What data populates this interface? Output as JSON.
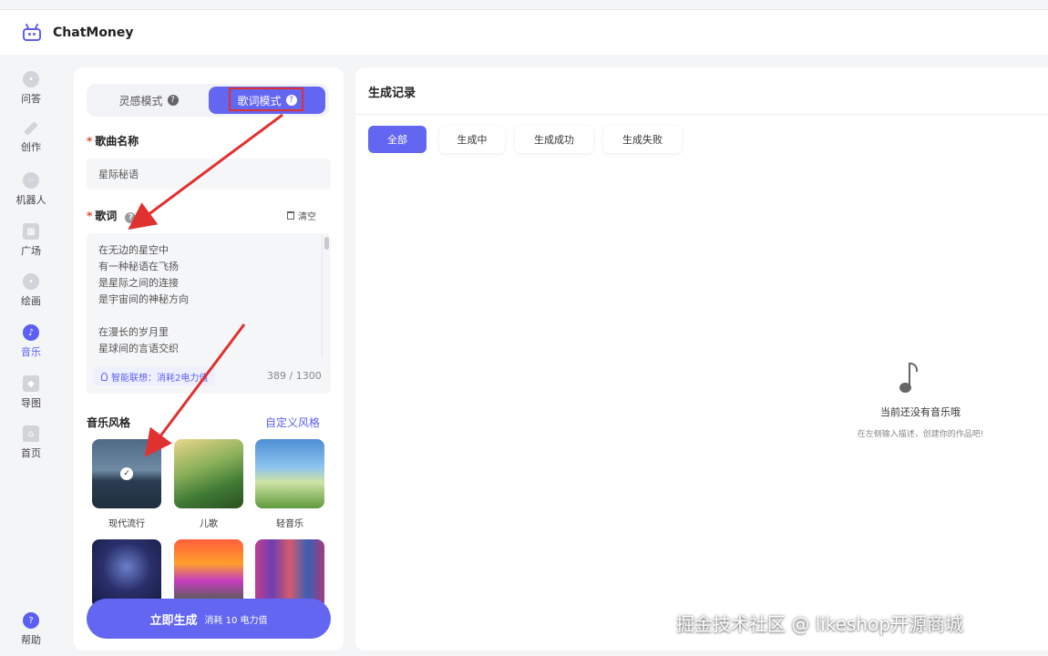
{
  "app": {
    "title": "ChatMoney"
  },
  "sidebar": {
    "items": [
      {
        "label": "问答",
        "icon": "chat-icon"
      },
      {
        "label": "创作",
        "icon": "pen-icon"
      },
      {
        "label": "机器人",
        "icon": "robot-icon"
      },
      {
        "label": "广场",
        "icon": "grid-icon"
      },
      {
        "label": "绘画",
        "icon": "palette-icon"
      },
      {
        "label": "音乐",
        "icon": "music-icon",
        "active": true
      },
      {
        "label": "导图",
        "icon": "cube-icon"
      },
      {
        "label": "首页",
        "icon": "home-icon"
      }
    ],
    "help_label": "帮助"
  },
  "left_panel": {
    "modes": {
      "inspire": "灵感模式",
      "lyric": "歌词模式",
      "active": "lyric"
    },
    "song_name": {
      "label": "歌曲名称",
      "value": "星际秘语"
    },
    "lyrics": {
      "label": "歌词",
      "clear_label": "清空",
      "text": "在无边的星空中\n有一种秘语在飞扬\n是星际之间的连接\n是宇宙间的神秘方向\n\n在漫长的岁月里\n星球间的言语交织",
      "smart_assoc": "智能联想：消耗2电力值",
      "count": "389 / 1300"
    },
    "styles": {
      "title": "音乐风格",
      "custom_label": "自定义风格",
      "items": [
        {
          "name": "现代流行",
          "selected": true
        },
        {
          "name": "儿歌"
        },
        {
          "name": "轻音乐"
        },
        {
          "name": ""
        },
        {
          "name": ""
        },
        {
          "name": ""
        }
      ]
    },
    "generate": {
      "label": "立即生成",
      "sub": "消耗 10 电力值"
    }
  },
  "right_panel": {
    "title": "生成记录",
    "tabs": [
      "全部",
      "生成中",
      "生成成功",
      "生成失败"
    ],
    "active_tab": "全部",
    "empty_title": "当前还没有音乐哦",
    "empty_sub": "在左侧输入描述，创建你的作品吧!"
  },
  "watermark": "掘金技术社区 @ likeshop开源商城",
  "colors": {
    "accent": "#6366f1",
    "annotation": "#e03131"
  }
}
